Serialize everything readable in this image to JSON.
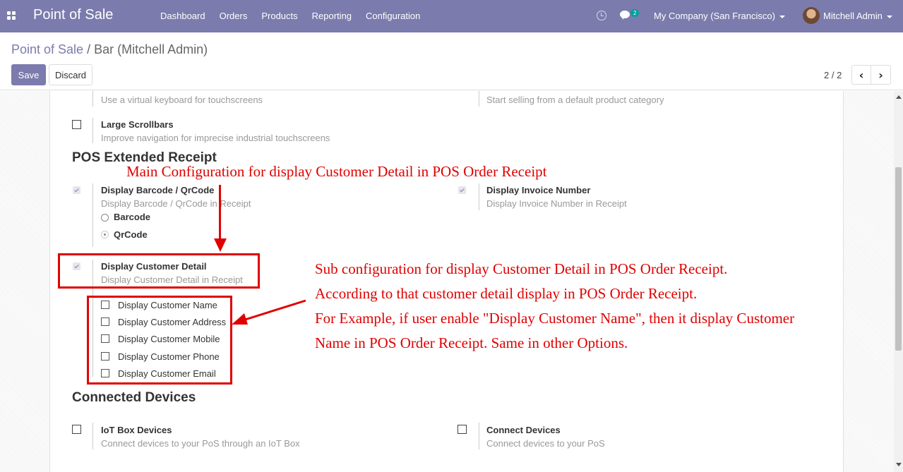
{
  "navbar": {
    "brand": "Point of Sale",
    "menu": [
      "Dashboard",
      "Orders",
      "Products",
      "Reporting",
      "Configuration"
    ],
    "chat_count": "2",
    "company": "My Company (San Francisco)",
    "user": "Mitchell Admin"
  },
  "control": {
    "breadcrumb_parent": "Point of Sale",
    "breadcrumb_sep": "/",
    "breadcrumb_current": "Bar (Mitchell Admin)",
    "save_label": "Save",
    "discard_label": "Discard",
    "pager": "2 / 2",
    "prev_label": "‹",
    "next_label": "›"
  },
  "settings": {
    "virtual_keyboard_help": "Use a virtual keyboard for touchscreens",
    "default_category_help": "Start selling from a default product category",
    "large_scrollbars_title": "Large Scrollbars",
    "large_scrollbars_help": "Improve navigation for imprecise industrial touchscreens",
    "section_receipt": "POS Extended Receipt",
    "barcode_title": "Display Barcode / QrCode",
    "barcode_help": "Display Barcode / QrCode in Receipt",
    "radio_barcode": "Barcode",
    "radio_qrcode": "QrCode",
    "invoice_title": "Display Invoice Number",
    "invoice_help": "Display Invoice Number in Receipt",
    "customer_title": "Display Customer Detail",
    "customer_help": "Display Customer Detail in Receipt",
    "customer_options": [
      "Display Customer Name",
      "Display Customer Address",
      "Display Customer Mobile",
      "Display Customer Phone",
      "Display Customer Email"
    ],
    "section_devices": "Connected Devices",
    "iot_title": "IoT Box Devices",
    "iot_help": "Connect devices to your PoS through an IoT Box",
    "connect_title": "Connect Devices",
    "connect_help": "Connect devices to your PoS"
  },
  "annotations": {
    "main": "Main Configuration for display Customer Detail in POS Order Receipt",
    "sub_line1": "Sub configuration for display Customer Detail in POS Order Receipt.",
    "sub_line2": "According to that customer detail display in POS Order Receipt.",
    "sub_line3": "For Example, if user enable \"Display Customer Name\", then it display Customer",
    "sub_line4": "Name in POS Order Receipt. Same in other Options."
  },
  "colors": {
    "navbar": "#7c7bad",
    "annotation_red": "#e00000"
  }
}
